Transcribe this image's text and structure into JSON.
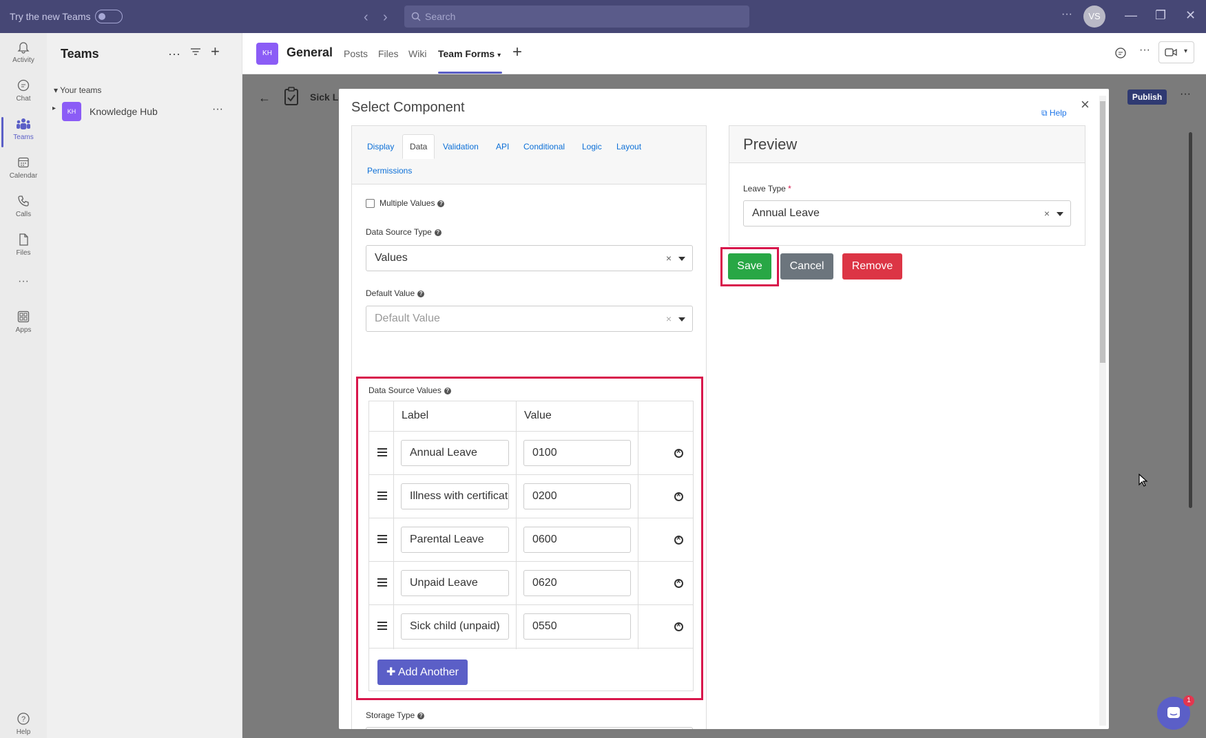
{
  "titlebar": {
    "try_label": "Try the new Teams",
    "search_placeholder": "Search",
    "avatar_initials": "VS"
  },
  "rail": [
    {
      "label": "Activity",
      "icon": "bell-icon"
    },
    {
      "label": "Chat",
      "icon": "chat-icon"
    },
    {
      "label": "Teams",
      "icon": "teams-icon",
      "active": true
    },
    {
      "label": "Calendar",
      "icon": "calendar-icon"
    },
    {
      "label": "Calls",
      "icon": "phone-icon"
    },
    {
      "label": "Files",
      "icon": "file-icon"
    },
    {
      "label": "Apps",
      "icon": "apps-icon"
    },
    {
      "label": "Help",
      "icon": "help-icon"
    }
  ],
  "teams_panel": {
    "title": "Teams",
    "section": "Your teams",
    "team": {
      "badge": "KH",
      "name": "Knowledge Hub"
    }
  },
  "channel": {
    "badge": "KH",
    "name": "General",
    "tabs": [
      "Posts",
      "Files",
      "Wiki",
      "Team Forms"
    ],
    "active_tab": "Team Forms"
  },
  "background": {
    "form_title": "Sick Le",
    "publish_label": "Publish"
  },
  "modal": {
    "title": "Select Component",
    "help_label": "Help",
    "tabs": [
      "Display",
      "Data",
      "Validation",
      "API",
      "Conditional",
      "Logic",
      "Layout",
      "Permissions"
    ],
    "active_tab": "Data",
    "multiple_values_label": "Multiple Values",
    "multiple_values_checked": false,
    "data_source_type_label": "Data Source Type",
    "data_source_type_value": "Values",
    "default_value_label": "Default Value",
    "default_value_placeholder": "Default Value",
    "ds_values_label": "Data Source Values",
    "ds_columns": [
      "Label",
      "Value"
    ],
    "ds_rows": [
      {
        "label": "Annual Leave",
        "value": "0100"
      },
      {
        "label": "Illness with certificate",
        "value": "0200"
      },
      {
        "label": "Parental Leave",
        "value": "0600"
      },
      {
        "label": "Unpaid Leave",
        "value": "0620"
      },
      {
        "label": "Sick child (unpaid)",
        "value": "0550"
      }
    ],
    "add_another_label": "Add Another",
    "storage_type_label": "Storage Type",
    "preview": {
      "title": "Preview",
      "field_label": "Leave Type",
      "required_mark": "*",
      "field_value": "Annual Leave"
    },
    "buttons": {
      "save": "Save",
      "cancel": "Cancel",
      "remove": "Remove"
    }
  },
  "chat_fab": {
    "badge": "1"
  },
  "colors": {
    "teams_purple": "#464775",
    "accent": "#5b5fc7",
    "save_green": "#28a745",
    "cancel_gray": "#6c757d",
    "remove_red": "#dc3545",
    "highlight": "#d8164b"
  }
}
